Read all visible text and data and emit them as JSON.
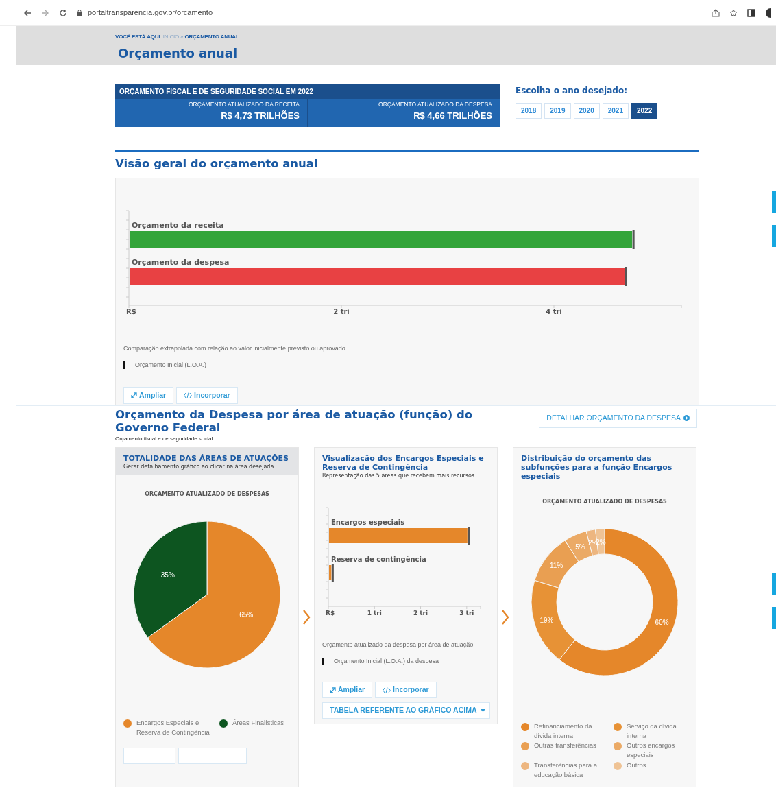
{
  "browser": {
    "url": "portaltransparencia.gov.br/orcamento"
  },
  "breadcrumb": {
    "label": "VOCÊ ESTÁ AQUI:",
    "items": [
      {
        "text": "INÍCIO",
        "current": false
      },
      {
        "text": "ORÇAMENTO ANUAL",
        "current": true
      }
    ],
    "separator": "»"
  },
  "page_title": "Orçamento anual",
  "summary": {
    "title": "ORÇAMENTO FISCAL E DE SEGURIDADE SOCIAL EM 2022",
    "items": [
      {
        "label": "ORÇAMENTO ATUALIZADO DA RECEITA",
        "value": "R$ 4,73 TRILHÕES"
      },
      {
        "label": "ORÇAMENTO ATUALIZADO DA DESPESA",
        "value": "R$ 4,66 TRILHÕES"
      }
    ]
  },
  "year_picker": {
    "label": "Escolha o ano desejado:",
    "years": [
      {
        "label": "2018",
        "selected": false
      },
      {
        "label": "2019",
        "selected": false
      },
      {
        "label": "2020",
        "selected": false
      },
      {
        "label": "2021",
        "selected": false
      },
      {
        "label": "2022",
        "selected": true
      }
    ]
  },
  "overview": {
    "title": "Visão geral do orçamento anual",
    "chart_data": {
      "type": "bar",
      "orientation": "horizontal",
      "categories": [
        "Orçamento da receita",
        "Orçamento da despesa"
      ],
      "series": [
        {
          "color": "#33a53a",
          "values": [
            4.73,
            null
          ]
        },
        {
          "color": "#e84143",
          "values": [
            null,
            4.66
          ]
        }
      ],
      "xlim": [
        0,
        5.2
      ],
      "xticks": [
        {
          "value": 0,
          "label": "R$"
        },
        {
          "value": 2,
          "label": "2 tri"
        },
        {
          "value": 4,
          "label": "4 tri"
        }
      ]
    },
    "note": "Comparação extrapolada com relação ao valor inicialmente previsto ou aprovado.",
    "legend_label": "Orçamento Inicial (L.O.A.)",
    "buttons": [
      {
        "kind": "expand",
        "label": "Ampliar"
      },
      {
        "kind": "embed",
        "label": "Incorporar"
      }
    ]
  },
  "spending": {
    "title": "Orçamento da Despesa por área de atuação (função) do Governo Federal",
    "subtitle": "Orçamento fiscal e de seguridade social",
    "detail_button": "DETALHAR ORÇAMENTO DA DESPESA",
    "cards": [
      {
        "kind": "pie",
        "title": "TOTALIDADE DAS ÁREAS DE ATUAÇÕES",
        "subtitle": "Gerar detalhamento gráfico ao clicar na área desejada",
        "shaded_header": true,
        "chart_title": "ORÇAMENTO ATUALIZADO DE DESPESAS",
        "chart_data": {
          "type": "pie",
          "values": [
            65,
            35
          ],
          "value_labels": [
            "65%",
            "35%"
          ]
        },
        "legend": [
          {
            "label": "Encargos Especiais e Reserva de Contingência",
            "color": "#e5872a"
          },
          {
            "label": "Áreas Finalísticas",
            "color": "#0d5520"
          }
        ]
      },
      {
        "kind": "bars",
        "title": "Visualização dos Encargos Especiais e Reserva de Contingência",
        "subtitle": "Representação das 5 áreas que recebem mais recursos",
        "shaded_header": false,
        "chart_data": {
          "type": "bar",
          "orientation": "horizontal",
          "categories": [
            "Encargos especiais",
            "Reserva de contingência"
          ],
          "series": [
            {
              "color": "#e5872a",
              "values": [
                3.0,
                0.05
              ]
            }
          ],
          "xlim": [
            0,
            3.3
          ],
          "xticks": [
            {
              "value": 0,
              "label": "R$"
            },
            {
              "value": 1,
              "label": "1 tri"
            },
            {
              "value": 2,
              "label": "2 tri"
            },
            {
              "value": 3,
              "label": "3 tri"
            }
          ]
        },
        "note": "Orçamento atualizado da despesa por área de atuação",
        "legend_label": "Orçamento Inicial (L.O.A.) da despesa",
        "buttons": [
          {
            "kind": "expand",
            "label": "Ampliar"
          },
          {
            "kind": "embed",
            "label": "Incorporar"
          }
        ],
        "table_button": "TABELA REFERENTE AO GRÁFICO ACIMA"
      },
      {
        "kind": "donut",
        "title": "Distribuição do orçamento das subfunções para a função Encargos especiais",
        "shaded_header": false,
        "chart_title": "ORÇAMENTO ATUALIZADO DE DESPESAS",
        "chart_data": {
          "type": "donut",
          "values": [
            60,
            19,
            11,
            5,
            2,
            2
          ],
          "value_labels": [
            "60%",
            "19%",
            "11%",
            "5%",
            "2%",
            "2%"
          ]
        },
        "legend": [
          {
            "label": "Refinanciamento da dívida interna",
            "color": "#e5872a"
          },
          {
            "label": "Serviço da dívida interna",
            "color": "#e79236"
          },
          {
            "label": "Outras transferências",
            "color": "#e99f52"
          },
          {
            "label": "Outros encargos especiais",
            "color": "#ebaa66"
          },
          {
            "label": "Transferências para a educação básica",
            "color": "#edb680"
          },
          {
            "label": "Outros",
            "color": "#efc395"
          }
        ]
      }
    ]
  }
}
